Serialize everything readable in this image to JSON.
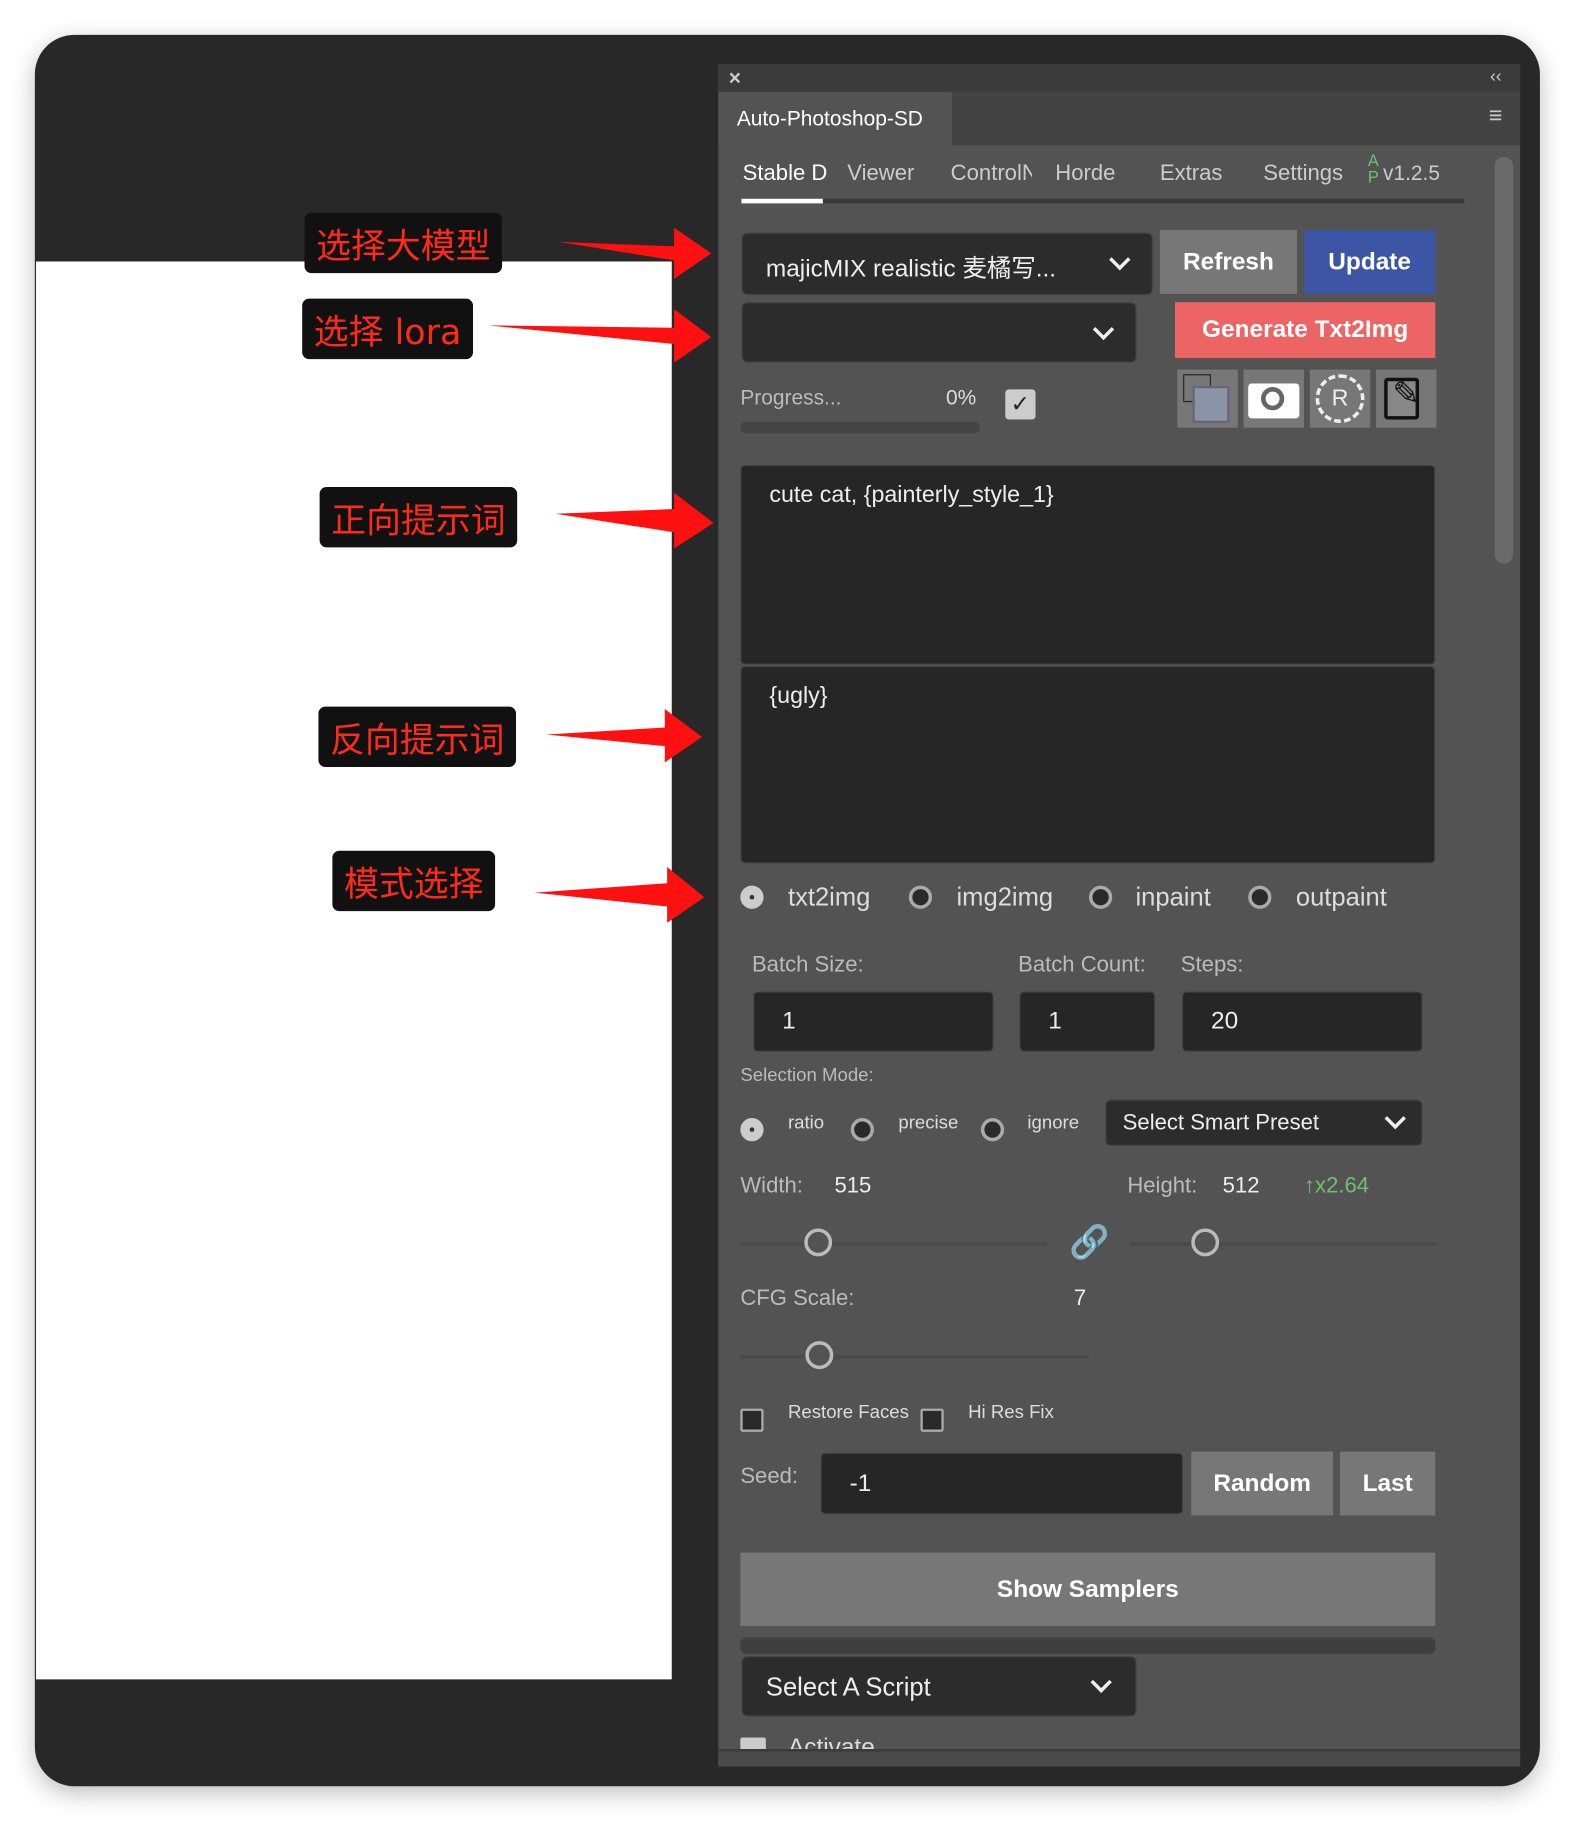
{
  "annotations": [
    {
      "label": "选择大模型"
    },
    {
      "label": "选择 lora"
    },
    {
      "label": "正向提示词"
    },
    {
      "label": "反向提示词"
    },
    {
      "label": "模式选择"
    }
  ],
  "panel": {
    "title": "Auto-Photoshop-SD",
    "close_icon": "close-icon",
    "collapse_icon": "double-chevron-left-icon",
    "menu_icon": "hamburger-menu-icon",
    "tabs": [
      {
        "label": "Stable D",
        "active": true
      },
      {
        "label": "Viewer"
      },
      {
        "label": "ControlN"
      },
      {
        "label": "Horde"
      },
      {
        "label": "Extras"
      },
      {
        "label": "Settings"
      }
    ],
    "logo": "AP",
    "version": "v1.2.5",
    "model_select": "majicMIX realistic 麦橘写...",
    "lora_select": "",
    "refresh": "Refresh",
    "update": "Update",
    "generate": "Generate Txt2Img",
    "progress_label": "Progress...",
    "progress_value": "0%",
    "progress": 0,
    "icons": [
      "image-layer-icon",
      "camera-icon",
      "reset-r-icon",
      "notes-edit-icon"
    ],
    "prompt": "cute cat, {painterly_style_1}",
    "negative_prompt": "{ugly}",
    "modes": [
      {
        "label": "txt2img",
        "selected": true
      },
      {
        "label": "img2img"
      },
      {
        "label": "inpaint"
      },
      {
        "label": "outpaint"
      }
    ],
    "batch_size_label": "Batch Size:",
    "batch_size": "1",
    "batch_count_label": "Batch Count:",
    "batch_count": "1",
    "steps_label": "Steps:",
    "steps": "20",
    "selection_mode_label": "Selection Mode:",
    "selection_modes": [
      {
        "label": "ratio",
        "selected": true
      },
      {
        "label": "precise"
      },
      {
        "label": "ignore"
      }
    ],
    "smart_preset": "Select Smart Preset",
    "width_label": "Width:",
    "width": "515",
    "height_label": "Height:",
    "height": "512",
    "scale": "↑x2.64",
    "cfg_label": "CFG Scale:",
    "cfg": "7",
    "restore_faces": "Restore Faces",
    "hi_res_fix": "Hi Res Fix",
    "seed_label": "Seed:",
    "seed": "-1",
    "random": "Random",
    "last": "Last",
    "show_samplers": "Show Samplers",
    "script_select": "Select A Script",
    "activate": "Activate",
    "colors": {
      "update": "#3c55a5",
      "generate": "#ec6464",
      "accent_green": "#6fbf6f",
      "annotation": "#ff2a1a"
    }
  }
}
